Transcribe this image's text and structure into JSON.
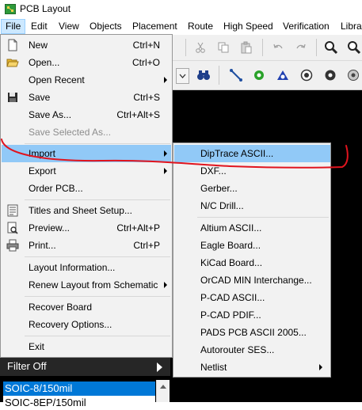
{
  "window": {
    "title": "PCB Layout"
  },
  "menubar": [
    "File",
    "Edit",
    "View",
    "Objects",
    "Placement",
    "Route",
    "High Speed",
    "Verification",
    "Libra"
  ],
  "file_menu": {
    "new": {
      "label": "New",
      "shortcut": "Ctrl+N",
      "icon": "new-document-icon"
    },
    "open": {
      "label": "Open...",
      "shortcut": "Ctrl+O",
      "icon": "folder-open-icon"
    },
    "open_recent": {
      "label": "Open Recent"
    },
    "save": {
      "label": "Save",
      "shortcut": "Ctrl+S",
      "icon": "floppy-disk-icon"
    },
    "save_as": {
      "label": "Save As...",
      "shortcut": "Ctrl+Alt+S"
    },
    "save_selected_as": {
      "label": "Save Selected As..."
    },
    "import": {
      "label": "Import"
    },
    "export": {
      "label": "Export"
    },
    "order_pcb": {
      "label": "Order PCB..."
    },
    "titles_sheet_setup": {
      "label": "Titles and Sheet Setup...",
      "icon": "titles-sheet-icon"
    },
    "preview": {
      "label": "Preview...",
      "shortcut": "Ctrl+Alt+P",
      "icon": "print-preview-icon"
    },
    "print": {
      "label": "Print...",
      "shortcut": "Ctrl+P",
      "icon": "printer-icon"
    },
    "layout_information": {
      "label": "Layout Information..."
    },
    "renew_layout": {
      "label": "Renew Layout from Schematic"
    },
    "recover_board": {
      "label": "Recover Board"
    },
    "recovery_options": {
      "label": "Recovery Options..."
    },
    "exit": {
      "label": "Exit"
    }
  },
  "import_menu": [
    "DipTrace ASCII...",
    "DXF...",
    "Gerber...",
    "N/C Drill...",
    "Altium ASCII...",
    "Eagle Board...",
    "KiCad Board...",
    "OrCAD MIN Interchange...",
    "P-CAD ASCII...",
    "P-CAD PDIF...",
    "PADS PCB ASCII 2005...",
    "Autorouter SES...",
    "Netlist"
  ],
  "filter": {
    "label": "Filter Off"
  },
  "footprints": {
    "selected": "SOIC-8/150mil",
    "next": "SOIC-8EP/150mil"
  },
  "colors": {
    "highlight": "#91c9f7",
    "menu_bg": "#f2f2f2",
    "annotation": "#e0141e",
    "selection": "#0078d7"
  }
}
